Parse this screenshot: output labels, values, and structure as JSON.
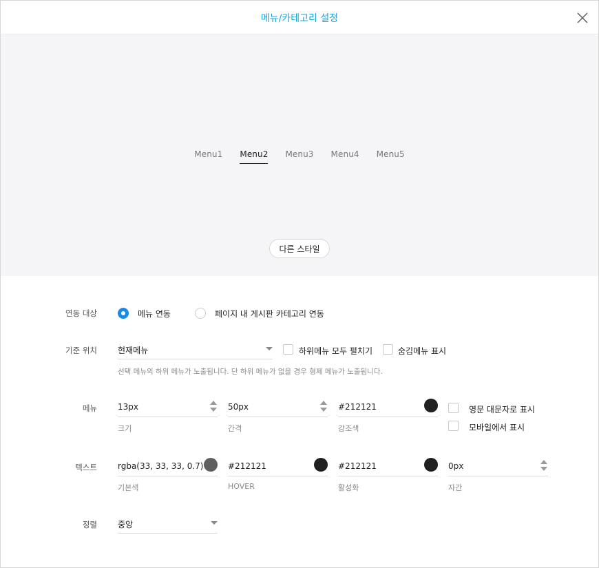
{
  "dialog": {
    "title": "메뉴/카테고리 설정",
    "close_icon": "close-icon"
  },
  "preview": {
    "menu_items": [
      "Menu1",
      "Menu2",
      "Menu3",
      "Menu4",
      "Menu5"
    ],
    "active_index": 1,
    "style_button": "다른 스타일"
  },
  "link": {
    "label": "연동 대상",
    "options": [
      "메뉴 연동",
      "페이지 내 게시판 카테고리 연동"
    ],
    "selected": "메뉴 연동"
  },
  "base_position": {
    "label": "기준 위치",
    "select_value": "현재메뉴",
    "checkbox_expand": "하위메뉴 모두 펼치기",
    "checkbox_hidden": "숨김메뉴 표시",
    "hint": "선택 메뉴의 하위 메뉴가 노출됩니다. 단 하위 메뉴가 없을 경우 형제 메뉴가 노출됩니다."
  },
  "menu": {
    "label": "메뉴",
    "size_value": "13px",
    "size_label": "크기",
    "gap_value": "50px",
    "gap_label": "간격",
    "accent_value": "#212121",
    "accent_label": "강조색",
    "accent_color": "#212121",
    "checkbox_uppercase": "영문 대문자로 표시",
    "checkbox_mobile": "모바일에서 표시"
  },
  "text": {
    "label": "텍스트",
    "base_value": "rgba(33, 33, 33, 0.7)",
    "base_label": "기본색",
    "base_color": "#5f5f5f",
    "hover_value": "#212121",
    "hover_label": "HOVER",
    "hover_color": "#212121",
    "active_value": "#212121",
    "active_label": "활성화",
    "active_color": "#212121",
    "spacing_value": "0px",
    "spacing_label": "자간"
  },
  "align": {
    "label": "정렬",
    "select_value": "중앙"
  },
  "colors": {
    "accent_title": "#1aa3d9",
    "radio_blue": "#1a8ce8"
  }
}
